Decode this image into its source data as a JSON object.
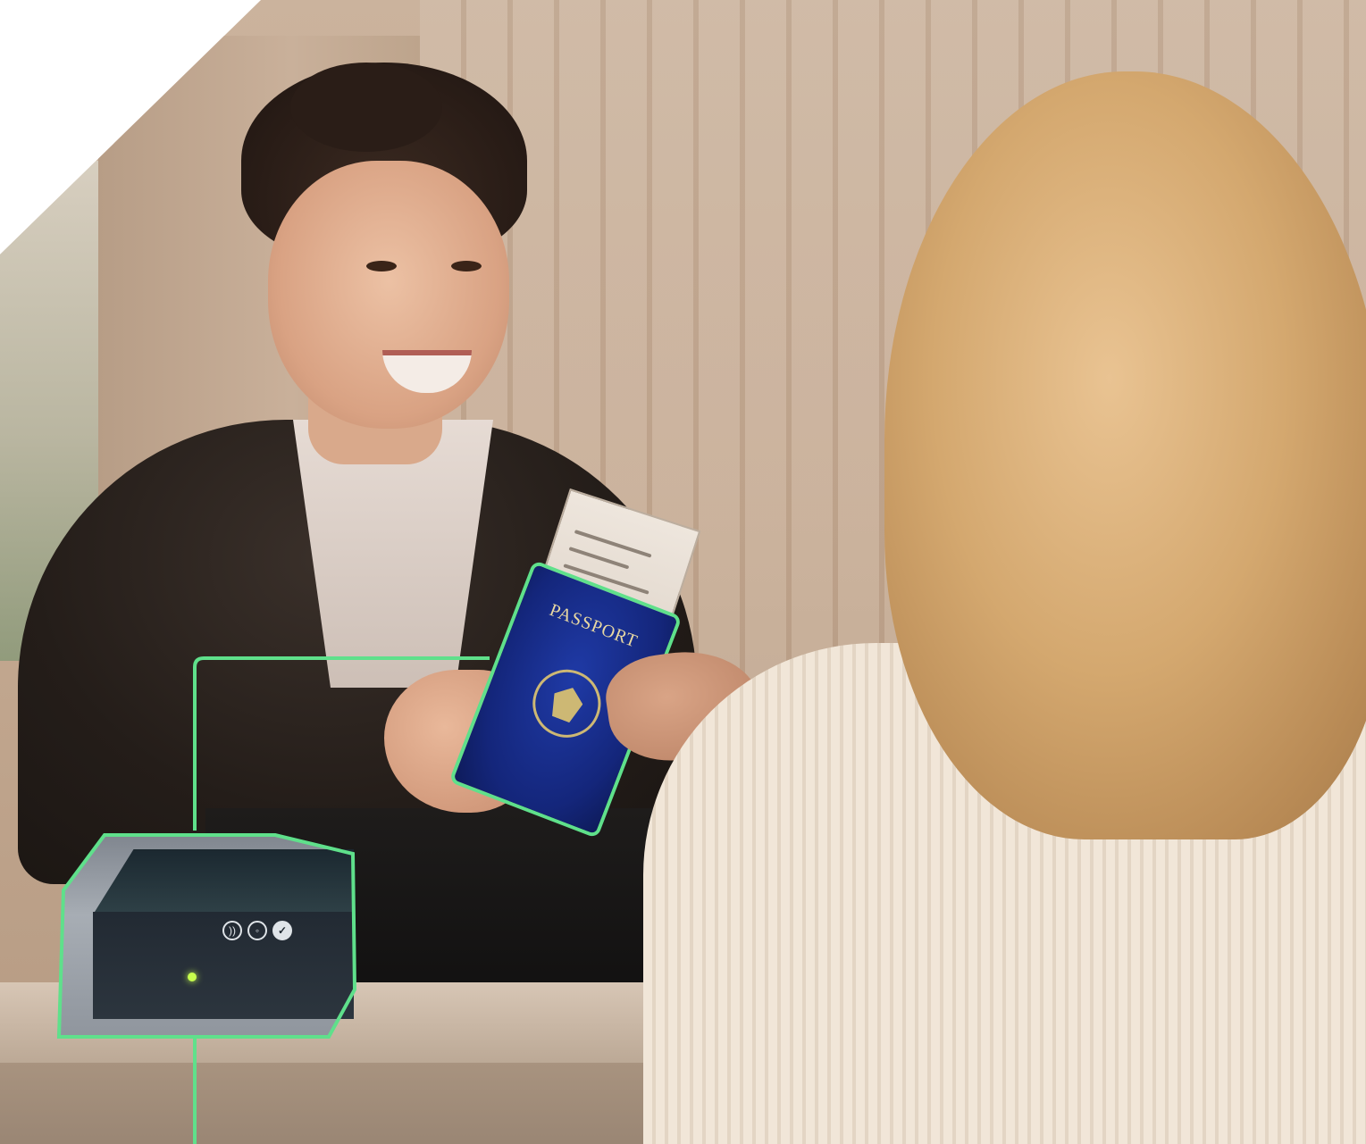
{
  "scene": {
    "passport_text": "PASSPORT",
    "scanner_icons": [
      "contactless-icon",
      "face-scan-icon",
      "checkmark-icon"
    ],
    "outline_color": "#5fe08b",
    "background_top_left": "#ffffff"
  }
}
